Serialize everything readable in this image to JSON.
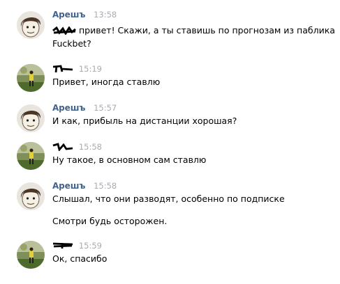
{
  "accent_author_color": "#42648b",
  "timestamp_color": "#a7acb2",
  "messages": [
    {
      "author": "Арешъ",
      "time": "13:58",
      "avatar": "cartoon-face-avatar",
      "lines": [
        "привет! Скажи, а ты ставишь по прогнозам из паблика",
        "Fuckbet?"
      ]
    },
    {
      "author": "",
      "time": "15:19",
      "avatar": "football-photo-avatar",
      "lines": [
        "Привет, иногда ставлю"
      ]
    },
    {
      "author": "Арешъ",
      "time": "15:57",
      "avatar": "cartoon-face-avatar",
      "lines": [
        "И как, прибыль на дистанции хорошая?"
      ]
    },
    {
      "author": "",
      "time": "15:58",
      "avatar": "football-photo-avatar",
      "lines": [
        "Ну такое, в основном сам ставлю"
      ]
    },
    {
      "author": "Арешъ",
      "time": "15:58",
      "avatar": "cartoon-face-avatar",
      "lines": [
        "Слышал, что они разводят, особенно по подписке"
      ],
      "extra": "Смотри будь осторожен."
    },
    {
      "author": "",
      "time": "15:59",
      "avatar": "football-photo-avatar",
      "lines": [
        "Ок, спасибо"
      ]
    }
  ]
}
